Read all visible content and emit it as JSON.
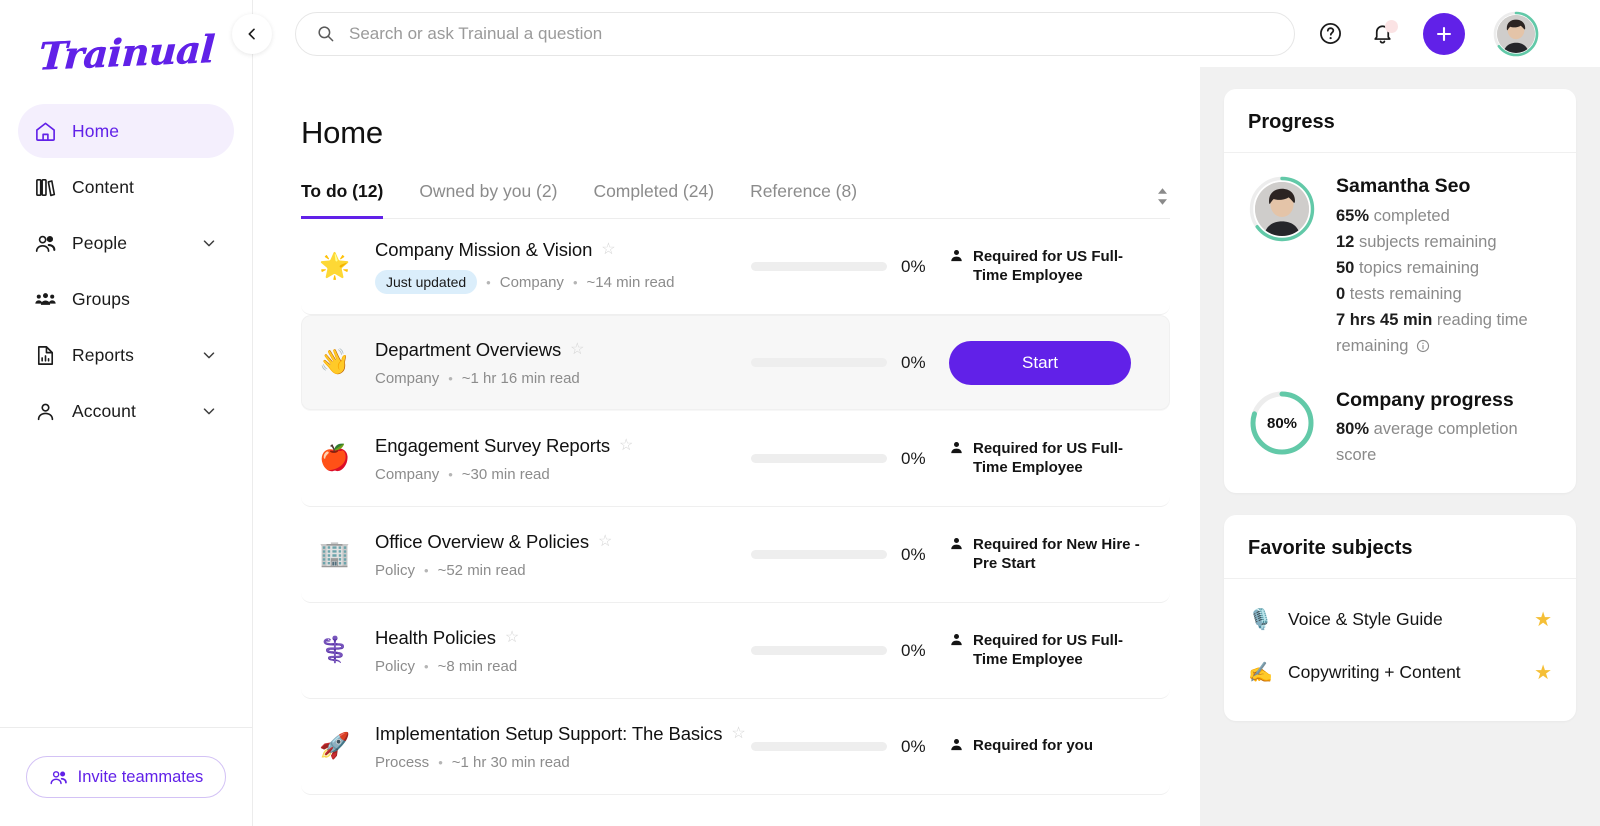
{
  "brand": {
    "logo_text": "Trainual",
    "primary_color": "#6121e8",
    "accent_teal": "#62c9a8",
    "star_yellow": "#f5bf36"
  },
  "sidebar": {
    "collapse_icon": "chevron-left-icon",
    "items": [
      {
        "label": "Home",
        "icon": "home-icon",
        "active": true,
        "expandable": false
      },
      {
        "label": "Content",
        "icon": "books-icon",
        "active": false,
        "expandable": false
      },
      {
        "label": "People",
        "icon": "people-icon",
        "active": false,
        "expandable": true
      },
      {
        "label": "Groups",
        "icon": "groups-icon",
        "active": false,
        "expandable": false
      },
      {
        "label": "Reports",
        "icon": "report-icon",
        "active": false,
        "expandable": true
      },
      {
        "label": "Account",
        "icon": "person-icon",
        "active": false,
        "expandable": true
      }
    ],
    "invite_label": "Invite teammates"
  },
  "topbar": {
    "search_placeholder": "Search or ask Trainual a question",
    "search_value": "",
    "help_icon": "question-circle-icon",
    "notifications_icon": "bell-icon",
    "add_icon": "plus-icon",
    "avatar_icon": "user-avatar"
  },
  "main": {
    "page_title": "Home",
    "tabs": [
      {
        "label": "To do (12)",
        "active": true
      },
      {
        "label": "Owned by you (2)",
        "active": false
      },
      {
        "label": "Completed (24)",
        "active": false
      },
      {
        "label": "Reference (8)",
        "active": false
      }
    ],
    "sort_icon": "sort-icon",
    "rows": [
      {
        "emoji": "🌟",
        "title": "Company Mission & Vision",
        "badge": "Just updated",
        "category": "Company",
        "read_time": "~14 min read",
        "progress": "0%",
        "progress_value": 0,
        "required": "Required for US Full-Time Employee",
        "action": null,
        "hover": false
      },
      {
        "emoji": "👋",
        "title": "Department Overviews",
        "badge": null,
        "category": "Company",
        "read_time": "~1 hr 16 min read",
        "progress": "0%",
        "progress_value": 0,
        "required": null,
        "action": "Start",
        "hover": true
      },
      {
        "emoji": "🍎",
        "title": "Engagement Survey Reports",
        "badge": null,
        "category": "Company",
        "read_time": "~30 min read",
        "progress": "0%",
        "progress_value": 0,
        "required": "Required for US Full-Time Employee",
        "action": null,
        "hover": false
      },
      {
        "emoji": "🏢",
        "title": "Office Overview & Policies",
        "badge": null,
        "category": "Policy",
        "read_time": "~52 min read",
        "progress": "0%",
        "progress_value": 0,
        "required": "Required for New Hire - Pre Start",
        "action": null,
        "hover": false
      },
      {
        "emoji": "⚕️",
        "title": "Health Policies",
        "badge": null,
        "category": "Policy",
        "read_time": "~8 min read",
        "progress": "0%",
        "progress_value": 0,
        "required": "Required for US Full-Time Employee",
        "action": null,
        "hover": false
      },
      {
        "emoji": "🚀",
        "title": "Implementation Setup Support: The Basics",
        "badge": null,
        "category": "Process",
        "read_time": "~1 hr 30 min read",
        "progress": "0%",
        "progress_value": 0,
        "required": "Required for you",
        "action": null,
        "hover": false
      }
    ]
  },
  "right": {
    "progress_card": {
      "title": "Progress",
      "user_name": "Samantha Seo",
      "user_percent": 65,
      "stats": [
        {
          "value": "65%",
          "label": "completed"
        },
        {
          "value": "12",
          "label": "subjects remaining"
        },
        {
          "value": "50",
          "label": "topics remaining"
        },
        {
          "value": "0",
          "label": "tests remaining"
        },
        {
          "value": "7 hrs 45 min",
          "label": "reading time remaining"
        }
      ],
      "info_icon": "info-circle-icon",
      "company": {
        "donut_label": "80%",
        "donut_value": 80,
        "title": "Company progress",
        "stat_value": "80%",
        "stat_label": "average completion score"
      }
    },
    "favorites_card": {
      "title": "Favorite subjects",
      "items": [
        {
          "emoji": "🎙️",
          "label": "Voice & Style Guide",
          "starred": true
        },
        {
          "emoji": "✍️",
          "label": "Copywriting + Content",
          "starred": true
        }
      ]
    }
  }
}
